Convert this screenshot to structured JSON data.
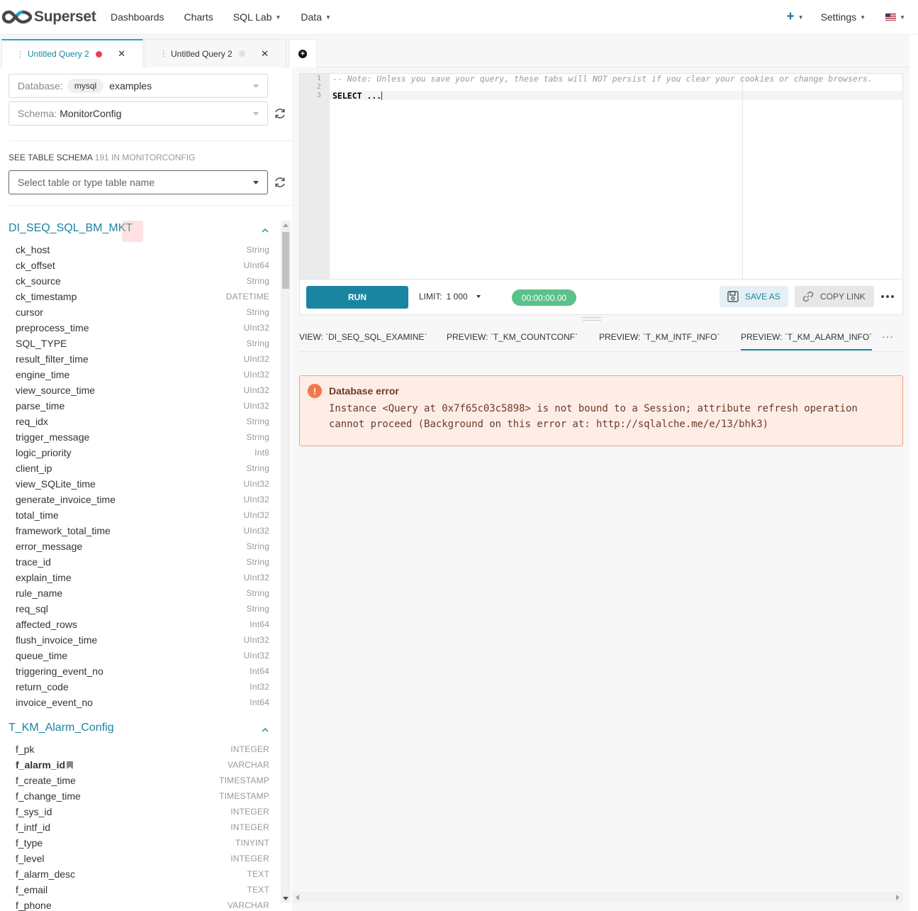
{
  "nav": {
    "brand": "Superset",
    "items": [
      {
        "label": "Dashboards",
        "dropdown": false
      },
      {
        "label": "Charts",
        "dropdown": false
      },
      {
        "label": "SQL Lab",
        "dropdown": true
      },
      {
        "label": "Data",
        "dropdown": true
      }
    ],
    "settings": "Settings"
  },
  "query_tabs": [
    {
      "label": "Untitled Query 2",
      "status_color": "#e04355",
      "active": true
    },
    {
      "label": "Untitled Query 2",
      "status_color": "#e0e0e0",
      "active": false
    }
  ],
  "left": {
    "database_label": "Database:",
    "database_engine": "mysql",
    "database_value": "examples",
    "schema_label": "Schema:",
    "schema_value": "MonitorConfig",
    "schema_header": "SEE TABLE SCHEMA",
    "schema_count": "191 IN MONITORCONFIG",
    "table_placeholder": "Select table or type table name"
  },
  "tables": [
    {
      "name": "DI_SEQ_SQL_BM_MKT",
      "columns": [
        {
          "name": "ck_host",
          "type": "String"
        },
        {
          "name": "ck_offset",
          "type": "UInt64"
        },
        {
          "name": "ck_source",
          "type": "String"
        },
        {
          "name": "ck_timestamp",
          "type": "DATETIME"
        },
        {
          "name": "cursor",
          "type": "String"
        },
        {
          "name": "preprocess_time",
          "type": "UInt32"
        },
        {
          "name": "SQL_TYPE",
          "type": "String"
        },
        {
          "name": "result_filter_time",
          "type": "UInt32"
        },
        {
          "name": "engine_time",
          "type": "UInt32"
        },
        {
          "name": "view_source_time",
          "type": "UInt32"
        },
        {
          "name": "parse_time",
          "type": "UInt32"
        },
        {
          "name": "req_idx",
          "type": "String"
        },
        {
          "name": "trigger_message",
          "type": "String"
        },
        {
          "name": "logic_priority",
          "type": "Int8"
        },
        {
          "name": "client_ip",
          "type": "String"
        },
        {
          "name": "view_SQLite_time",
          "type": "UInt32"
        },
        {
          "name": "generate_invoice_time",
          "type": "UInt32"
        },
        {
          "name": "total_time",
          "type": "UInt32"
        },
        {
          "name": "framework_total_time",
          "type": "UInt32"
        },
        {
          "name": "error_message",
          "type": "String"
        },
        {
          "name": "trace_id",
          "type": "String"
        },
        {
          "name": "explain_time",
          "type": "UInt32"
        },
        {
          "name": "rule_name",
          "type": "String"
        },
        {
          "name": "req_sql",
          "type": "String"
        },
        {
          "name": "affected_rows",
          "type": "Int64"
        },
        {
          "name": "flush_invoice_time",
          "type": "UInt32"
        },
        {
          "name": "queue_time",
          "type": "UInt32"
        },
        {
          "name": "triggering_event_no",
          "type": "Int64"
        },
        {
          "name": "return_code",
          "type": "Int32"
        },
        {
          "name": "invoice_event_no",
          "type": "Int64"
        }
      ]
    },
    {
      "name": "T_KM_Alarm_Config",
      "columns": [
        {
          "name": "f_pk",
          "type": "INTEGER"
        },
        {
          "name": "f_alarm_id",
          "type": "VARCHAR",
          "key": true
        },
        {
          "name": "f_create_time",
          "type": "TIMESTAMP"
        },
        {
          "name": "f_change_time",
          "type": "TIMESTAMP"
        },
        {
          "name": "f_sys_id",
          "type": "INTEGER"
        },
        {
          "name": "f_intf_id",
          "type": "INTEGER"
        },
        {
          "name": "f_type",
          "type": "TINYINT"
        },
        {
          "name": "f_level",
          "type": "INTEGER"
        },
        {
          "name": "f_alarm_desc",
          "type": "TEXT"
        },
        {
          "name": "f_email",
          "type": "TEXT"
        },
        {
          "name": "f_phone",
          "type": "VARCHAR"
        }
      ]
    }
  ],
  "editor": {
    "lines": [
      {
        "n": "1",
        "text": "-- Note: Unless you save your query, these tabs will NOT persist if you clear your cookies or change browsers.",
        "kind": "comment"
      },
      {
        "n": "2",
        "text": "",
        "kind": "blank"
      },
      {
        "n": "3",
        "text": "SELECT ...",
        "kind": "kw"
      }
    ]
  },
  "toolbar": {
    "run": "RUN",
    "limit_label": "LIMIT:",
    "limit_value": "1 000",
    "timer": "00:00:00.00",
    "save_as": "SAVE AS",
    "copy_link": "COPY LINK"
  },
  "result_tabs": [
    {
      "label": "VIEW: `DI_SEQ_SQL_EXAMINE`",
      "active": false
    },
    {
      "label": "PREVIEW: `T_KM_COUNTCONF`",
      "active": false
    },
    {
      "label": "PREVIEW: `T_KM_INTF_INFO`",
      "active": false
    },
    {
      "label": "PREVIEW: `T_KM_ALARM_INFO`",
      "active": true
    }
  ],
  "error": {
    "title": "Database error",
    "line1": "Instance <Query at 0x7f65c03c5898> is not bound to a Session; attribute refresh operation",
    "line2": "cannot proceed (Background on this error at: http://sqlalche.me/e/13/bhk3)"
  },
  "colors": {
    "accent": "#1985a0",
    "run": "#1a85a0",
    "timer": "#59c189",
    "error_bg": "#fdede6",
    "error_border": "#f0a07a"
  }
}
